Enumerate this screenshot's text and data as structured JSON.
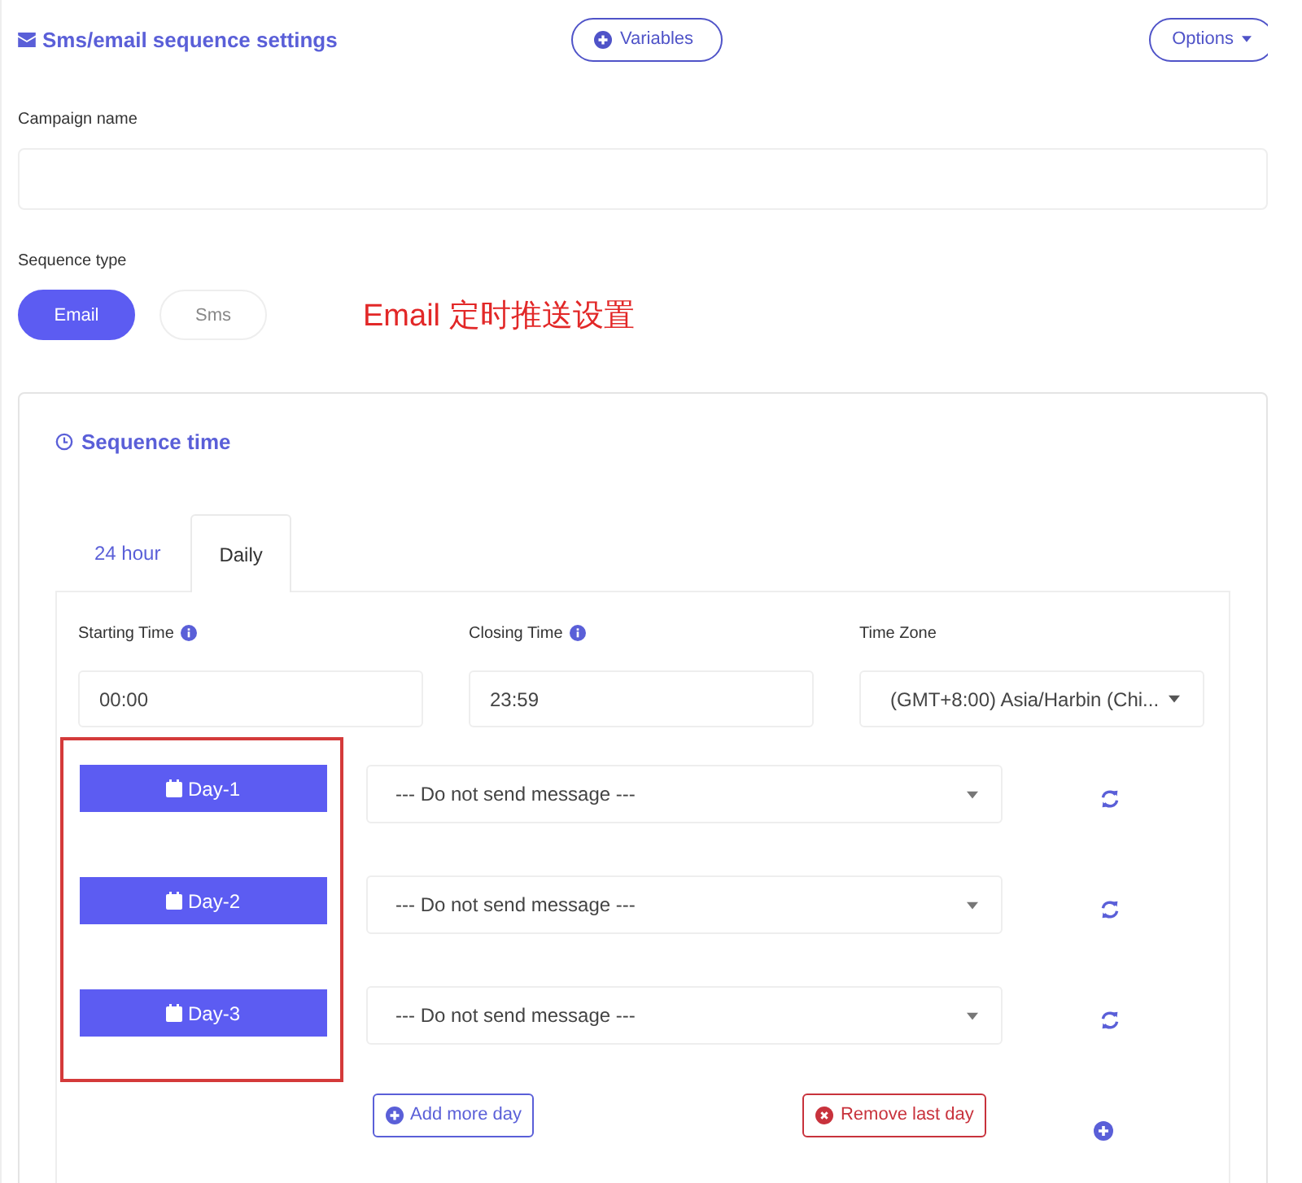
{
  "header": {
    "title": "Sms/email sequence settings",
    "variables_button": "Variables",
    "options_button": "Options"
  },
  "campaign": {
    "label": "Campaign name"
  },
  "sequence_type": {
    "label": "Sequence type",
    "options": [
      {
        "label": "Email",
        "selected": true
      },
      {
        "label": "Sms",
        "selected": false
      }
    ]
  },
  "annotation": {
    "text": "Email 定时推送设置"
  },
  "sequence_time": {
    "title": "Sequence time",
    "tabs": [
      {
        "label": "24 hour",
        "selected": false
      },
      {
        "label": "Daily",
        "selected": true
      }
    ],
    "fields": [
      {
        "label": "Starting Time",
        "info": true,
        "kind": "input",
        "value": "00:00"
      },
      {
        "label": "Closing Time",
        "info": true,
        "kind": "input",
        "value": "23:59"
      },
      {
        "label": "Time Zone",
        "info": false,
        "kind": "select",
        "value": "(GMT+8:00) Asia/Harbin (Chi..."
      }
    ],
    "days": [
      {
        "label": "Day-1",
        "message": "--- Do not send message ---"
      },
      {
        "label": "Day-2",
        "message": "--- Do not send message ---"
      },
      {
        "label": "Day-3",
        "message": "--- Do not send message ---"
      }
    ],
    "add_button": "Add more day",
    "remove_button": "Remove last day"
  }
}
